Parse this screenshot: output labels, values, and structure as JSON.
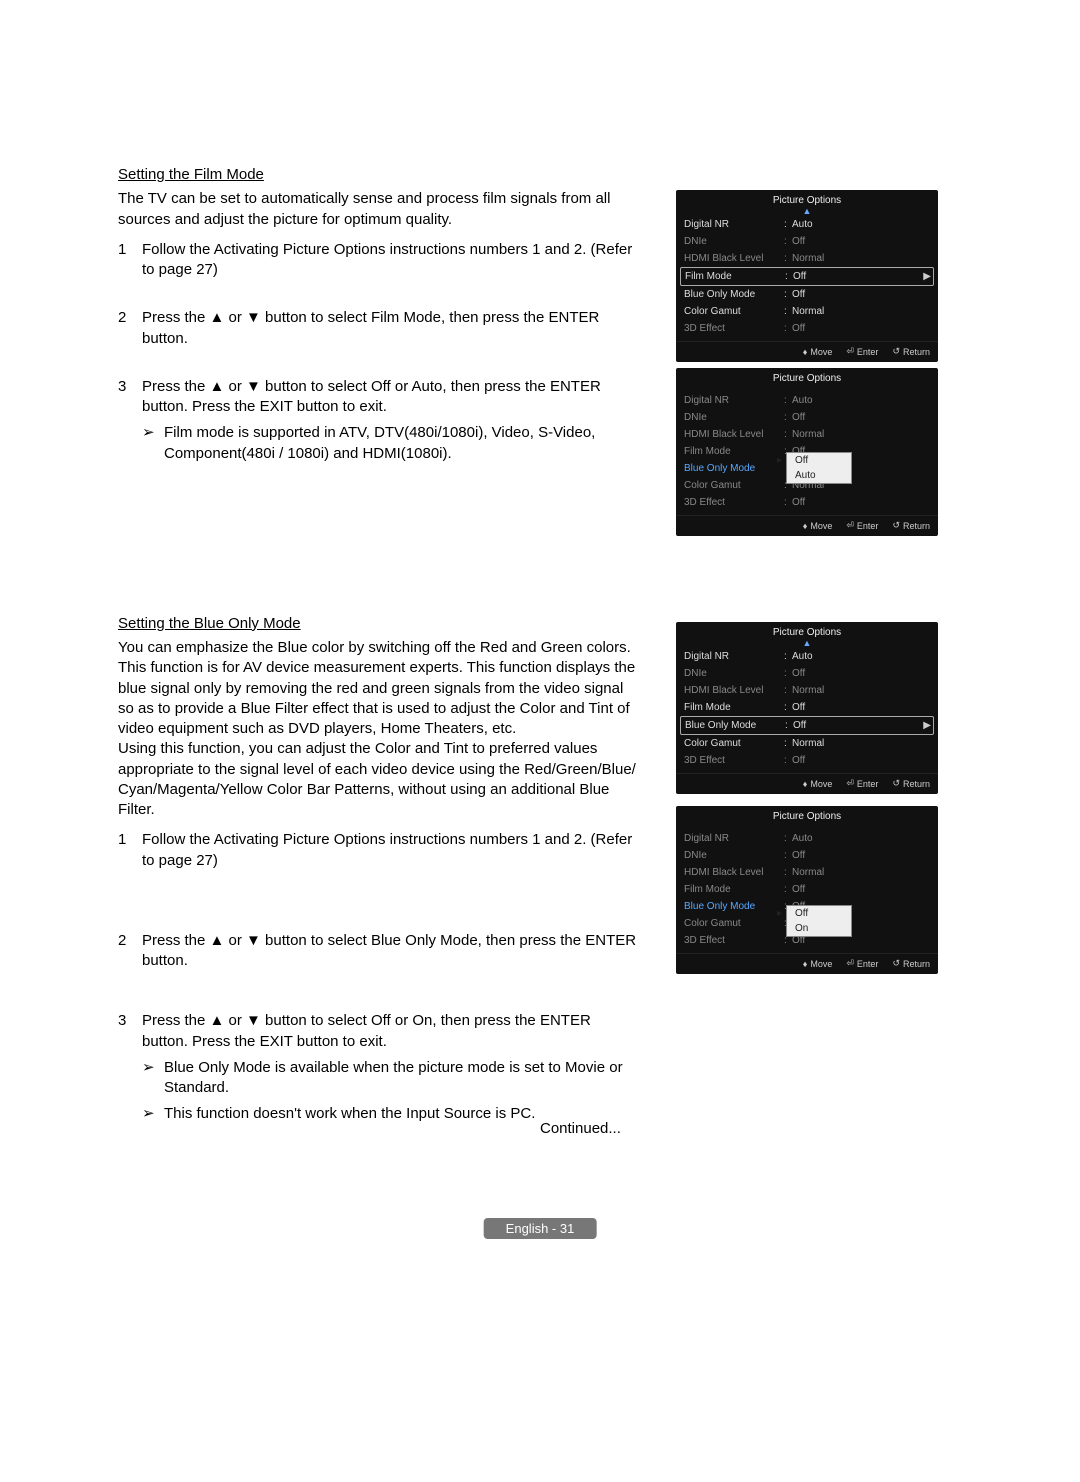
{
  "section1": {
    "title": "Setting the Film Mode",
    "intro": "The TV can be set to automatically sense and process film signals from all sources and adjust the picture for optimum quality.",
    "steps": [
      "Follow the Activating Picture Options instructions numbers 1 and 2. (Refer to page 27)",
      "Press the ▲ or ▼ button to select Film Mode, then press the ENTER button.",
      "Press the ▲ or ▼ button to select Off or Auto, then press the ENTER button. Press the EXIT button to exit."
    ],
    "note": "Film mode is supported in ATV, DTV(480i/1080i), Video, S-Video, Component(480i / 1080i) and HDMI(1080i)."
  },
  "section2": {
    "title": "Setting the Blue Only Mode",
    "intro": "You can emphasize the Blue color by switching off the Red and Green colors. This function is for AV device measurement experts. This function displays the blue signal only by removing the red and green signals from the video signal so as to provide a Blue Filter effect that is used to adjust the Color and Tint of video equipment such as DVD players, Home Theaters, etc.\nUsing this function, you can adjust the Color and Tint to preferred values appropriate to the signal level of each video device using the Red/Green/Blue/ Cyan/Magenta/Yellow Color Bar Patterns, without using an additional Blue Filter.",
    "steps": [
      "Follow the Activating Picture Options instructions numbers 1 and 2. (Refer to page 27)",
      "Press the ▲ or ▼ button to select Blue Only Mode, then press the ENTER button.",
      "Press the ▲ or ▼ button to select Off or On, then press the ENTER button. Press the EXIT button to exit."
    ],
    "notes": [
      "Blue Only Mode is available when the picture mode is set to Movie or Standard.",
      "This function doesn't work when the Input Source is PC."
    ]
  },
  "continued": "Continued...",
  "pageLabel": "English - 31",
  "osd": {
    "title": "Picture Options",
    "footer": {
      "move": "Move",
      "enter": "Enter",
      "return": "Return"
    },
    "items": {
      "digitalNR": "Digital NR",
      "dnie": "DNIe",
      "hdmiBlack": "HDMI Black Level",
      "filmMode": "Film Mode",
      "blueOnly": "Blue Only Mode",
      "colorGamut": "Color Gamut",
      "effect3d": "3D Effect"
    },
    "vals": {
      "auto": "Auto",
      "off": "Off",
      "on": "On",
      "normal": "Normal"
    }
  }
}
